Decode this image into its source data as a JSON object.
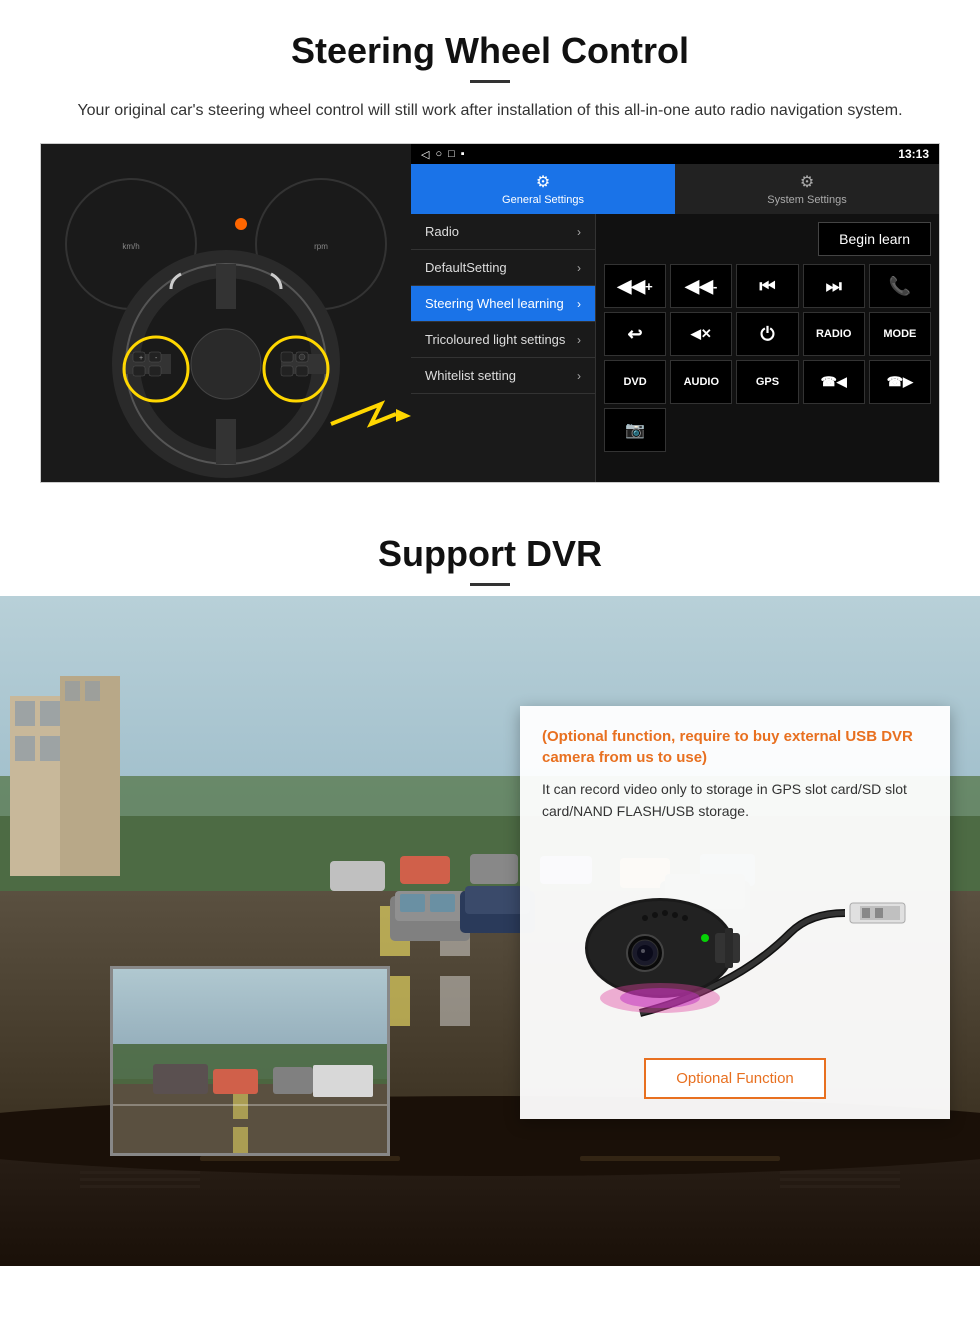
{
  "steering_section": {
    "title": "Steering Wheel Control",
    "subtitle": "Your original car's steering wheel control will still work after installation of this all-in-one auto radio navigation system.",
    "android_ui": {
      "statusbar": {
        "back_icon": "◁",
        "home_icon": "○",
        "square_icon": "□",
        "menu_icon": "▪",
        "time": "13:13",
        "signal_icon": "▾",
        "wifi_icon": "▾"
      },
      "tabs": [
        {
          "label": "General Settings",
          "icon": "⚙",
          "active": true
        },
        {
          "label": "System Settings",
          "icon": "⚙",
          "active": false
        }
      ],
      "menu_items": [
        {
          "label": "Radio",
          "active": false
        },
        {
          "label": "DefaultSetting",
          "active": false
        },
        {
          "label": "Steering Wheel learning",
          "active": true
        },
        {
          "label": "Tricoloured light settings",
          "active": false
        },
        {
          "label": "Whitelist setting",
          "active": false
        }
      ],
      "begin_learn_label": "Begin learn",
      "control_buttons_row1": [
        {
          "label": "◀◀+",
          "type": "icon"
        },
        {
          "label": "◀◀-",
          "type": "icon"
        },
        {
          "label": "◀◀",
          "type": "icon"
        },
        {
          "label": "▶▶",
          "type": "icon"
        },
        {
          "label": "☎",
          "type": "icon"
        }
      ],
      "control_buttons_row2": [
        {
          "label": "↩",
          "type": "icon"
        },
        {
          "label": "◀×",
          "type": "icon"
        },
        {
          "label": "⏻",
          "type": "icon"
        },
        {
          "label": "RADIO",
          "type": "text"
        },
        {
          "label": "MODE",
          "type": "text"
        }
      ],
      "control_buttons_row3": [
        {
          "label": "DVD",
          "type": "text"
        },
        {
          "label": "AUDIO",
          "type": "text"
        },
        {
          "label": "GPS",
          "type": "text"
        },
        {
          "label": "☎◀",
          "type": "icon"
        },
        {
          "label": "☎▶▶",
          "type": "icon"
        }
      ],
      "control_buttons_row4": [
        {
          "label": "📷",
          "type": "icon"
        }
      ]
    }
  },
  "dvr_section": {
    "title": "Support DVR",
    "info_card": {
      "optional_note": "(Optional function, require to buy external USB DVR camera from us to use)",
      "description": "It can record video only to storage in GPS slot card/SD slot card/NAND FLASH/USB storage.",
      "optional_function_label": "Optional Function"
    }
  }
}
